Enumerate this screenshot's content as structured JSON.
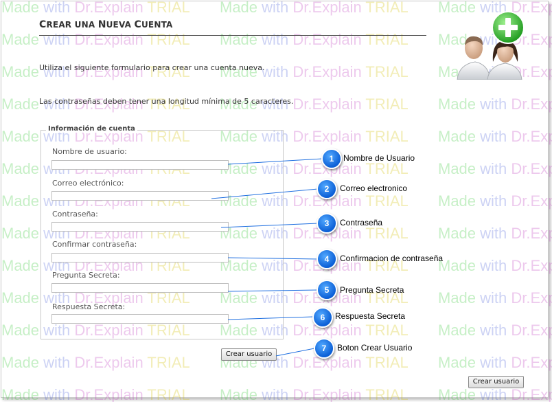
{
  "watermark": {
    "made": "Made",
    "with": "with",
    "brand": "Dr.Explain",
    "trial": "TRIAL"
  },
  "page": {
    "title_prefix": "C",
    "title_rest": "REAR UNA ",
    "title_n": "N",
    "title_ueva": "UEVA ",
    "title_c": "C",
    "title_uenta": "UENTA",
    "intro": "Utiliza el siguiente formulario para crear una cuenta nueva.",
    "password_note": "Las contraseñas deben tener una longitud mínima de 5 caracteres."
  },
  "form": {
    "legend": "Información de cuenta",
    "fields": [
      {
        "label": "Nombre de usuario:",
        "value": ""
      },
      {
        "label": "Correo electrónico:",
        "value": ""
      },
      {
        "label": "Contraseña:",
        "value": ""
      },
      {
        "label": "Confirmar contraseña:",
        "value": ""
      },
      {
        "label": "Pregunta Secreta:",
        "value": ""
      },
      {
        "label": "Respuesta Secreta:",
        "value": ""
      }
    ],
    "submit_label": "Crear usuario"
  },
  "bottom_button_label": "Crear usuario",
  "callouts": [
    {
      "number": "1",
      "text": "Nombre de Usuario"
    },
    {
      "number": "2",
      "text": "Correo electronico"
    },
    {
      "number": "3",
      "text": "Contraseña"
    },
    {
      "number": "4",
      "text": "Confirmacion de contraseña"
    },
    {
      "number": "5",
      "text": "Pregunta Secreta"
    },
    {
      "number": "6",
      "text": "Respuesta Secreta"
    },
    {
      "number": "7",
      "text": "Boton Crear Usuario"
    }
  ],
  "colors": {
    "callout_bubble": "#0b5fd6",
    "callout_line": "#1f6fe0",
    "plus_badge": "#2fb52f"
  },
  "icons": {
    "header_illustration": "add-users-icon"
  }
}
